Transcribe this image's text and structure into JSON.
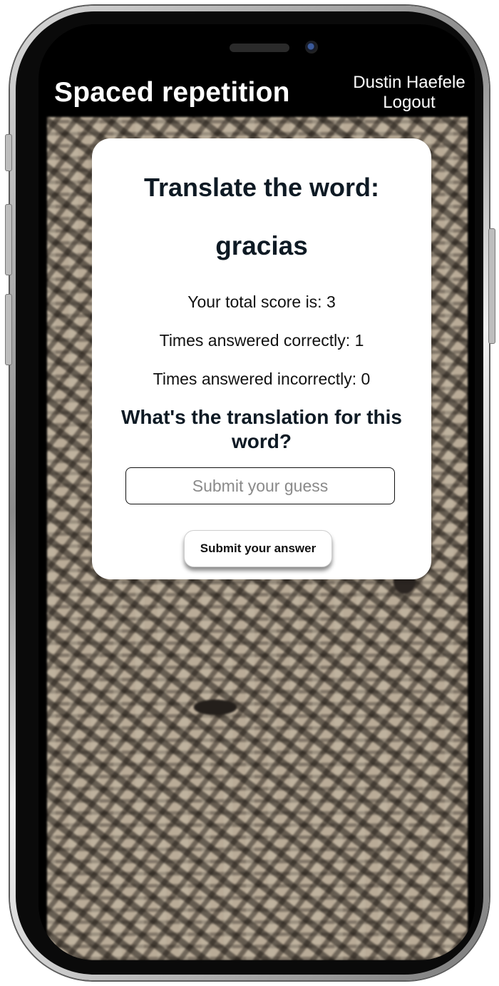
{
  "header": {
    "app_title": "Spaced repetition",
    "user_name": "Dustin Haefele",
    "logout_label": "Logout"
  },
  "card": {
    "heading": "Translate the word:",
    "word": "gracias",
    "total_score": "Your total score is: 3",
    "correct_count": "Times answered correctly: 1",
    "incorrect_count": "Times answered incorrectly: 0",
    "question": "What's the translation for this word?",
    "input": {
      "value": "",
      "placeholder": "Submit your guess"
    },
    "submit_label": "Submit your answer"
  }
}
